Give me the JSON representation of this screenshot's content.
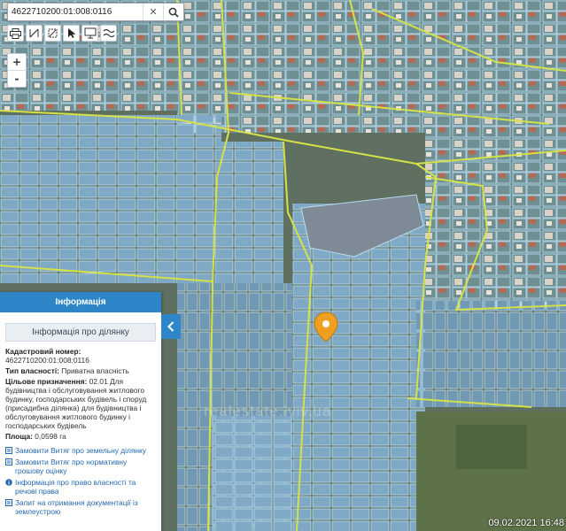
{
  "search": {
    "value": "4622710200:01:008:0116"
  },
  "toolbar": {
    "tools": [
      "printer-icon",
      "ruler-icon",
      "area-measure-icon",
      "pointer-icon",
      "monitor-icon",
      "layers-icon"
    ]
  },
  "zoom": {
    "in": "+",
    "out": "-"
  },
  "panel": {
    "header": "Інформація",
    "subheader": "Інформація про ділянку",
    "cadastral_label": "Кадастровий номер:",
    "cadastral_value": "4622710200:01:008:0116",
    "ownership_label": "Тип власності:",
    "ownership_value": "Приватна власність",
    "purpose_label": "Цільове призначення:",
    "purpose_value": "02.01 Для будівництва і обслуговування житлового будинку, господарських будівель і споруд (присадибна ділянка) для будівництва і обслуговування житлового будинку і господарських будівель",
    "area_label": "Площа:",
    "area_value": "0,0598 га",
    "links": [
      "Замовити Витяг про земельну ділянку",
      "Замовити Витяг про нормативну грошову оцінку",
      "Інформація про право власності та речові права",
      "Запит на отримання документації із землеустрою"
    ]
  },
  "watermark": "realestate.lviv.ua",
  "timestamp": "09.02.2021 16:48",
  "colors": {
    "header_blue": "#2e86c8",
    "road_yellow": "#d4e24a",
    "parcel_blue": "#8fc1e0",
    "marker": "#f0a020"
  }
}
